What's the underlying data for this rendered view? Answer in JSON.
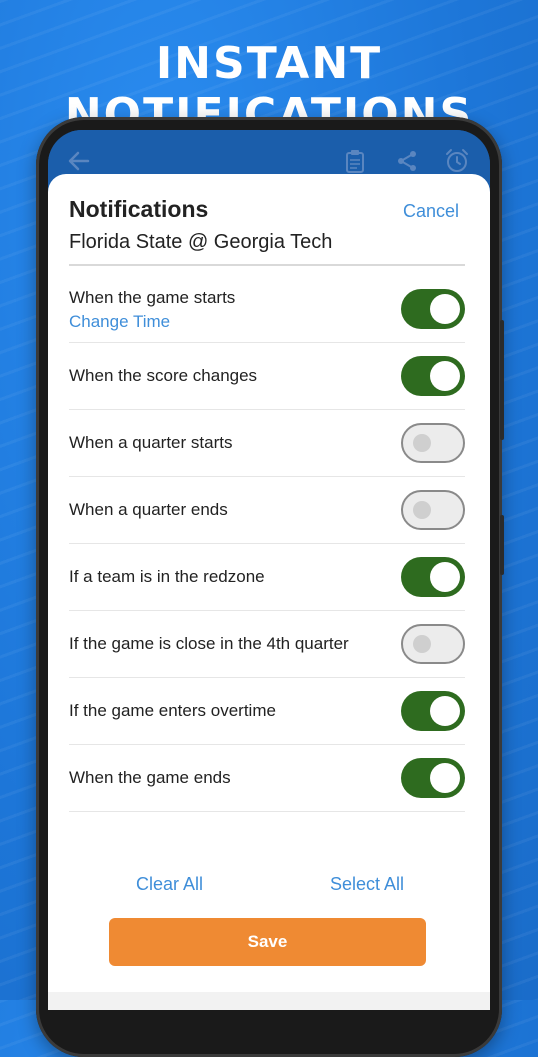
{
  "headline": "INSTANT NOTIFICATIONS",
  "appbar": {
    "icons": [
      "back-arrow-icon",
      "clipboard-icon",
      "share-icon",
      "alarm-clock-icon"
    ]
  },
  "sheet": {
    "title": "Notifications",
    "cancel_label": "Cancel",
    "subtitle": "Florida State @ Georgia Tech",
    "options": [
      {
        "label": "When the game starts",
        "sublink": "Change Time",
        "enabled": true
      },
      {
        "label": "When the score changes",
        "enabled": true
      },
      {
        "label": "When a quarter starts",
        "enabled": false
      },
      {
        "label": "When a quarter ends",
        "enabled": false
      },
      {
        "label": "If a team is in the redzone",
        "enabled": true
      },
      {
        "label": "If the game is close in the 4th quarter",
        "enabled": false
      },
      {
        "label": "If the game enters overtime",
        "enabled": true
      },
      {
        "label": "When the game ends",
        "enabled": true
      }
    ],
    "clear_all_label": "Clear All",
    "select_all_label": "Select All",
    "save_label": "Save"
  },
  "colors": {
    "background_blue": "#1f7fe0",
    "toggle_on": "#2e6b1f",
    "link_blue": "#3f8ed9",
    "save_orange": "#ef8a33"
  }
}
